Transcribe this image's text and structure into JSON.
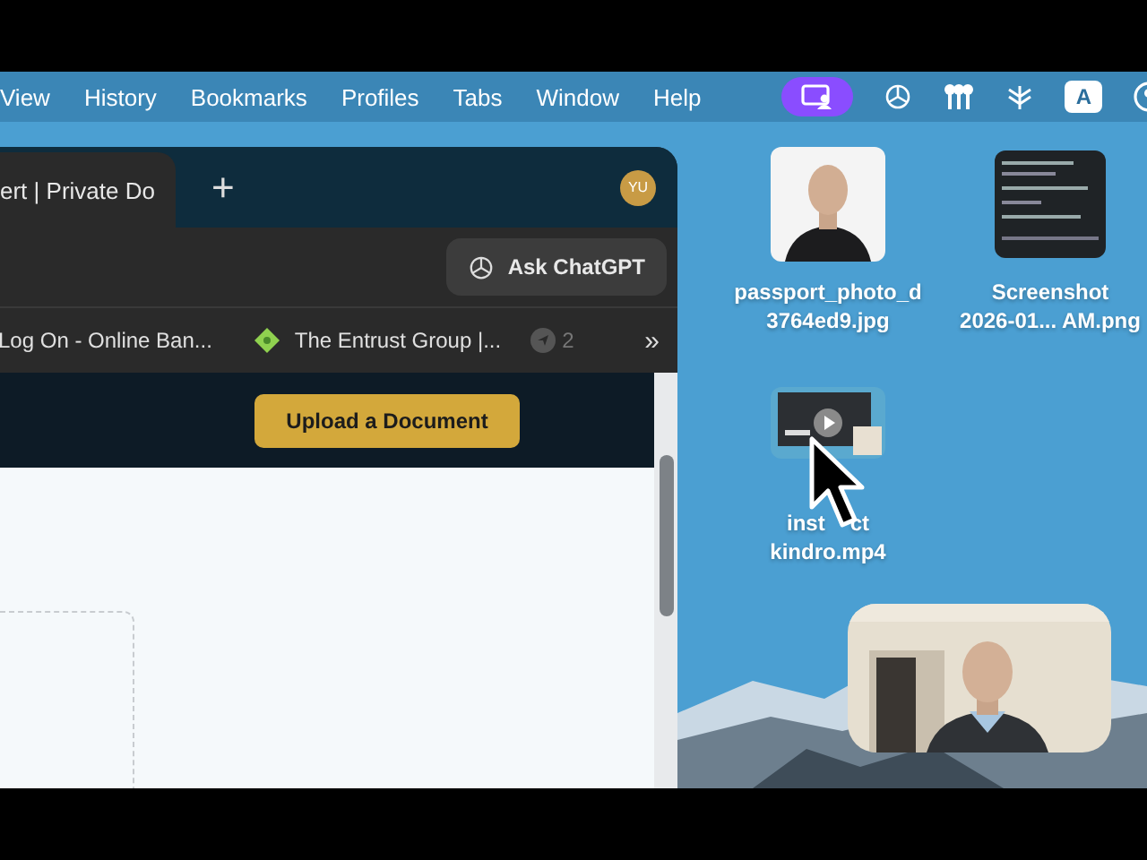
{
  "menu_bar": {
    "items": [
      "View",
      "History",
      "Bookmarks",
      "Profiles",
      "Tabs",
      "Window",
      "Help"
    ],
    "input_source": "A"
  },
  "browser": {
    "tabs": [
      {
        "title": "ert | Private Do",
        "selected": true
      }
    ],
    "new_tab": "+",
    "profile": "YU",
    "ask_button": "Ask ChatGPT",
    "bookmarks": [
      {
        "kind": "plain",
        "label": "Log On - Online Ban..."
      },
      {
        "kind": "favicon",
        "label": "The Entrust Group |..."
      }
    ],
    "bookmark_count": "2",
    "overflow": "»",
    "page": {
      "upload_button": "Upload a Document"
    }
  },
  "desktop": {
    "files": [
      {
        "lines": [
          {
            "parts": [
              "passport_photo_d"
            ]
          },
          {
            "parts": [
              "3764ed9.jpg"
            ]
          }
        ]
      },
      {
        "kind": "screenshot",
        "lines": [
          {
            "parts": [
              "Screenshot"
            ]
          },
          {
            "parts": [
              "2026-01... AM.png"
            ]
          }
        ]
      },
      {
        "kind": "video",
        "lines": [
          {
            "parts": [
              "inst",
              "ct"
            ]
          },
          {
            "parts": [
              "kindro.mp4"
            ]
          }
        ]
      }
    ]
  }
}
